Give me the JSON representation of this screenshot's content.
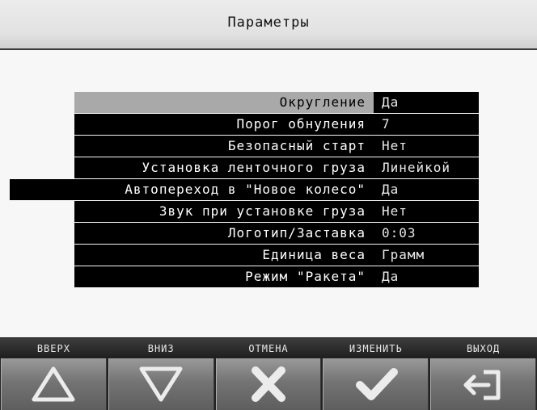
{
  "header": {
    "title": "Параметры"
  },
  "params": [
    {
      "label": "Округление",
      "value": "Да"
    },
    {
      "label": "Порог обнуления",
      "value": "7"
    },
    {
      "label": "Безопасный старт",
      "value": "Нет"
    },
    {
      "label": "Установка ленточного груза",
      "value": "Линейкой"
    },
    {
      "label": "Автопереход в \"Новое колесо\"",
      "value": "Да"
    },
    {
      "label": "Звук при установке груза",
      "value": "Нет"
    },
    {
      "label": "Логотип/Заставка",
      "value": "0:03"
    },
    {
      "label": "Единица веса",
      "value": "Грамм"
    },
    {
      "label": "Режим \"Ракета\"",
      "value": "Да"
    }
  ],
  "toolbar": {
    "labels": [
      "ВВЕРХ",
      "ВНИЗ",
      "ОТМЕНА",
      "ИЗМЕНИТЬ",
      "ВЫХОД"
    ],
    "icons": [
      "up-triangle-icon",
      "down-triangle-icon",
      "cross-icon",
      "check-icon",
      "exit-icon"
    ]
  },
  "colors": {
    "selected_row": "#a9a9a9",
    "row_bg": "#000000",
    "button": "#7a7a7a"
  }
}
